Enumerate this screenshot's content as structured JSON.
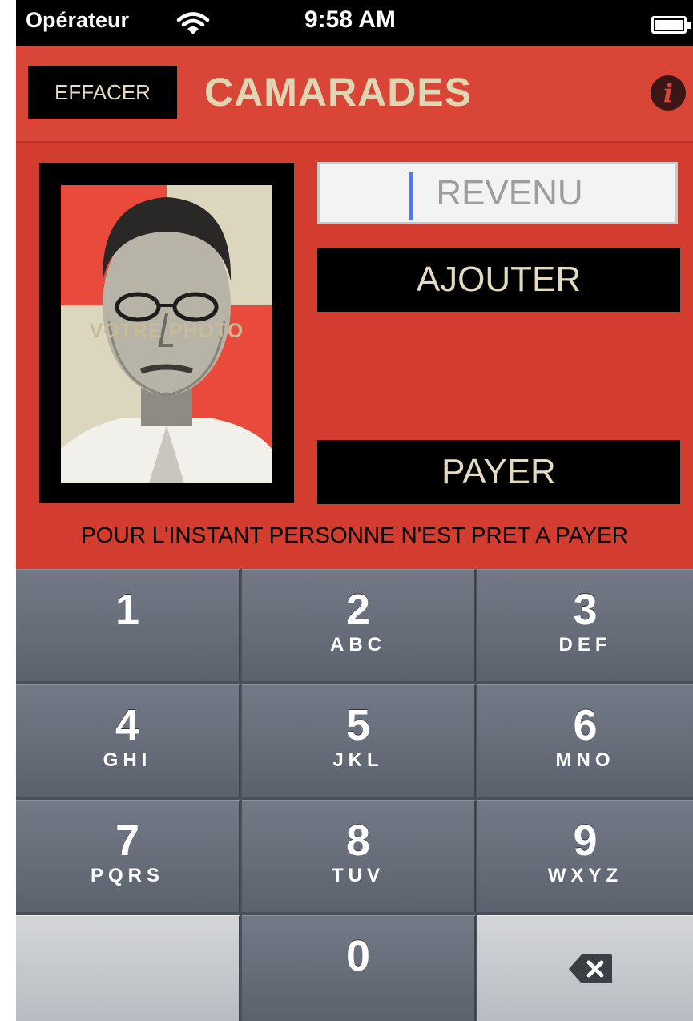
{
  "status_bar": {
    "carrier": "Opérateur",
    "time": "9:58 AM",
    "wifi_icon": "wifi-icon",
    "battery_icon": "battery-icon"
  },
  "navbar": {
    "clear_label": "EFFACER",
    "title": "CAMARADES",
    "info_icon": "info-icon",
    "info_glyph": "i"
  },
  "main": {
    "photo_label": "VOTRE PHOTO",
    "income_placeholder": "REVENU",
    "add_label": "AJOUTER",
    "pay_label": "PAYER",
    "status_message": "POUR L'INSTANT PERSONNE N'EST PRET A PAYER"
  },
  "keypad": {
    "keys": [
      {
        "num": "1",
        "letters": ""
      },
      {
        "num": "2",
        "letters": "ABC"
      },
      {
        "num": "3",
        "letters": "DEF"
      },
      {
        "num": "4",
        "letters": "GHI"
      },
      {
        "num": "5",
        "letters": "JKL"
      },
      {
        "num": "6",
        "letters": "MNO"
      },
      {
        "num": "7",
        "letters": "PQRS"
      },
      {
        "num": "8",
        "letters": "TUV"
      },
      {
        "num": "9",
        "letters": "WXYZ"
      },
      {
        "num": "0",
        "letters": ""
      }
    ],
    "delete_icon": "backspace-icon"
  },
  "colors": {
    "accent_red": "#d23d30",
    "title_cream": "#e1d6b3",
    "button_black": "#000000",
    "keypad_gray": "#5c626d"
  }
}
